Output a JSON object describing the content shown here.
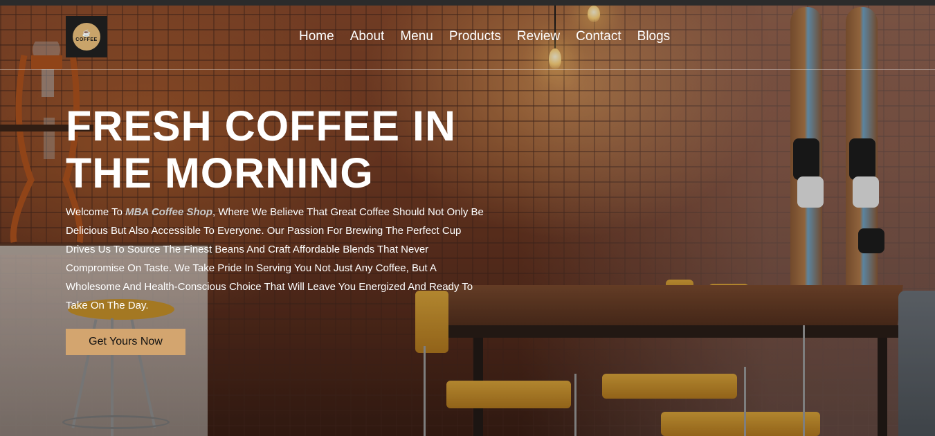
{
  "logo": {
    "text": "COFFEE",
    "icon": "coffee-cup-icon"
  },
  "nav": {
    "items": [
      {
        "label": "Home"
      },
      {
        "label": "About"
      },
      {
        "label": "Menu"
      },
      {
        "label": "Products"
      },
      {
        "label": "Review"
      },
      {
        "label": "Contact"
      },
      {
        "label": "Blogs"
      }
    ]
  },
  "hero": {
    "title_line1": "FRESH COFFEE IN",
    "title_line2": "THE MORNING",
    "text_before": "Welcome To ",
    "brand": "MBA Coffee Shop",
    "text_after": ", Where We Believe That Great Coffee Should Not Only Be Delicious But Also Accessible To Everyone. Our Passion For Brewing The Perfect Cup Drives Us To Source The Finest Beans And Craft Affordable Blends That Never Compromise On Taste. We Take Pride In Serving You Not Just Any Coffee, But A Wholesome And Health-Conscious Choice That Will Leave You Energized And Ready To Take On The Day.",
    "cta_label": "Get Yours Now"
  },
  "colors": {
    "accent": "#d3a56f",
    "text": "#ffffff",
    "brand_highlight": "#c9c9c9"
  }
}
